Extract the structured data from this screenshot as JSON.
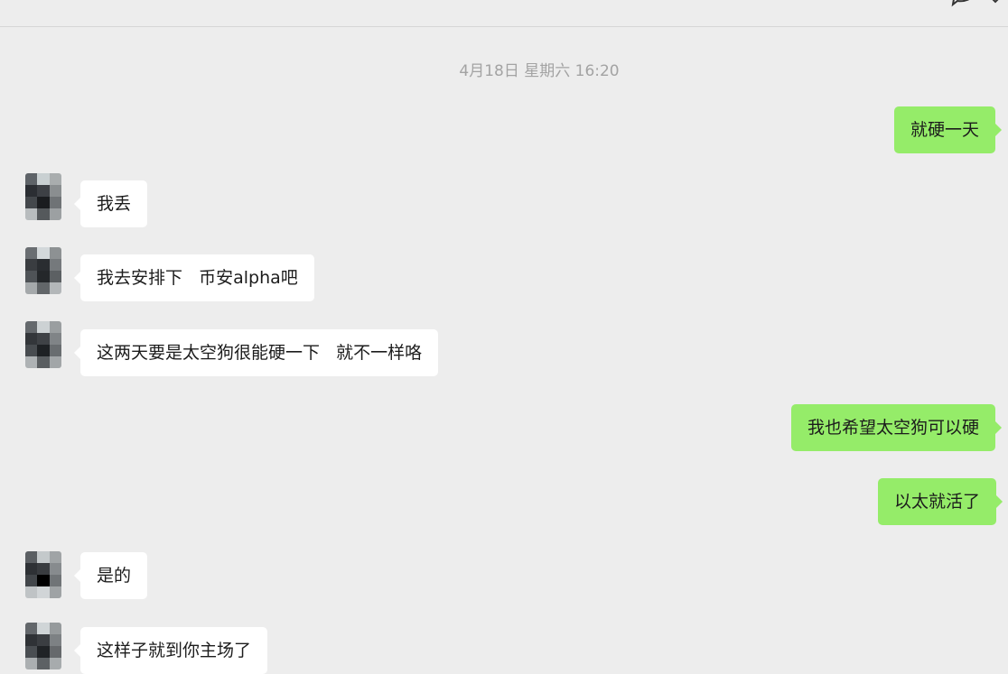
{
  "header": {
    "chat_icon": "chat-bubble-icon",
    "chevron_icon": "chevron-down-icon"
  },
  "chat": {
    "timestamp": "4月18日 星期六 16:20",
    "messages": [
      {
        "side": "out",
        "text": "就硬一天"
      },
      {
        "side": "in",
        "text": "我丢"
      },
      {
        "side": "in",
        "text": "我去安排下   币安alpha吧"
      },
      {
        "side": "in",
        "text": "这两天要是太空狗很能硬一下   就不一样咯"
      },
      {
        "side": "out",
        "text": "我也希望太空狗可以硬"
      },
      {
        "side": "out",
        "text": "以太就活了"
      },
      {
        "side": "in",
        "text": "是的"
      },
      {
        "side": "in",
        "text": "这样子就到你主场了"
      }
    ]
  },
  "colors": {
    "background": "#ededed",
    "incoming_bubble": "#ffffff",
    "outgoing_bubble": "#95ec69",
    "timestamp_text": "#a3a3a3"
  }
}
